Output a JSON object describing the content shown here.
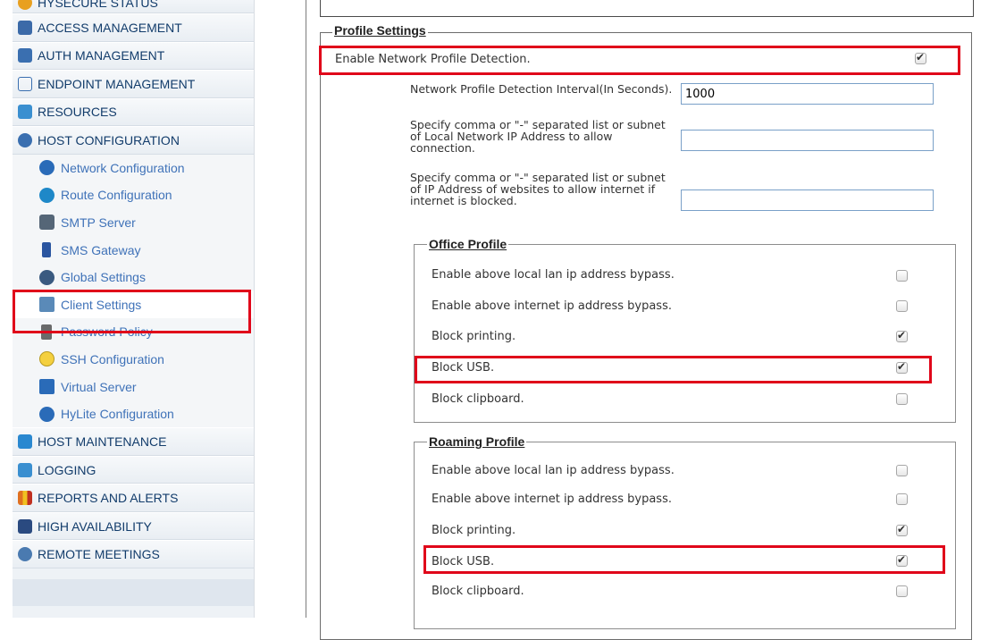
{
  "sidebar": {
    "top_partial_label": "HYSECURE STATUS",
    "items_before": [
      {
        "label": "ACCESS MANAGEMENT",
        "icon": "access-management-icon",
        "color": "#3b6aa8"
      },
      {
        "label": "AUTH MANAGEMENT",
        "icon": "lock-icon",
        "color": "#3a6fb0"
      },
      {
        "label": "ENDPOINT MANAGEMENT",
        "icon": "scale-icon",
        "color": "#3a6fb0"
      },
      {
        "label": "RESOURCES",
        "icon": "resources-icon",
        "color": "#3a8fd0"
      },
      {
        "label": "HOST CONFIGURATION",
        "icon": "gears-icon",
        "color": "#3a6fb0"
      }
    ],
    "sub_items": [
      {
        "label": "Network Configuration",
        "icon": "network-icon",
        "color": "#2a6bb8"
      },
      {
        "label": "Route Configuration",
        "icon": "globe-icon",
        "color": "#1e88c8"
      },
      {
        "label": "SMTP Server",
        "icon": "server-icon",
        "color": "#556677"
      },
      {
        "label": "SMS Gateway",
        "icon": "phone-icon",
        "color": "#2a55a0"
      },
      {
        "label": "Global Settings",
        "icon": "settings-icon",
        "color": "#3a5a80"
      },
      {
        "label": "Client Settings",
        "icon": "client-settings-icon",
        "color": "#5a8ab8"
      },
      {
        "label": "Password Policy",
        "icon": "hourglass-icon",
        "color": "#6a6a6a"
      },
      {
        "label": "SSH Configuration",
        "icon": "bulb-icon",
        "color": "#f4d03f"
      },
      {
        "label": "Virtual Server",
        "icon": "virtual-server-icon",
        "color": "#2a6bb8"
      },
      {
        "label": "HyLite Configuration",
        "icon": "hylite-icon",
        "color": "#2a6bb8"
      }
    ],
    "items_after": [
      {
        "label": "HOST MAINTENANCE",
        "icon": "maintenance-icon",
        "color": "#2a88d0"
      },
      {
        "label": "LOGGING",
        "icon": "calendar-icon",
        "color": "#3a8fd0"
      },
      {
        "label": "REPORTS AND ALERTS",
        "icon": "bar-chart-icon",
        "color": "#e07020"
      },
      {
        "label": "HIGH AVAILABILITY",
        "icon": "ha-icon",
        "color": "#2a4a80"
      },
      {
        "label": "REMOTE MEETINGS",
        "icon": "meetings-icon",
        "color": "#4a7ab0"
      }
    ]
  },
  "profile_settings": {
    "legend": "Profile Settings",
    "enable_detection_label": "Enable Network Profile Detection.",
    "enable_detection_checked": true,
    "interval_label": "Network Profile Detection Interval(In Seconds).",
    "interval_value": "1000",
    "local_ip_label": "Specify comma or \"-\" separated list or subnet of Local Network IP Address to allow connection.",
    "local_ip_value": "",
    "websites_label": "Specify comma or \"-\" separated list or subnet of IP Address of websites to allow internet if internet is blocked.",
    "websites_value": ""
  },
  "office_profile": {
    "legend": "Office Profile",
    "options": [
      {
        "label": "Enable above local lan ip address bypass.",
        "checked": false
      },
      {
        "label": "Enable above internet ip address bypass.",
        "checked": false
      },
      {
        "label": "Block printing.",
        "checked": true
      },
      {
        "label": "Block USB.",
        "checked": true
      },
      {
        "label": "Block clipboard.",
        "checked": false
      }
    ]
  },
  "roaming_profile": {
    "legend": "Roaming Profile",
    "options": [
      {
        "label": "Enable above local lan ip address bypass.",
        "checked": false
      },
      {
        "label": "Enable above internet ip address bypass.",
        "checked": false
      },
      {
        "label": "Block printing.",
        "checked": true
      },
      {
        "label": "Block USB.",
        "checked": true
      },
      {
        "label": "Block clipboard.",
        "checked": false
      }
    ]
  },
  "colors": {
    "highlight": "#e0061a",
    "sidebar_text": "#123c6b",
    "sidebar_sub_text": "#3f72b8"
  }
}
